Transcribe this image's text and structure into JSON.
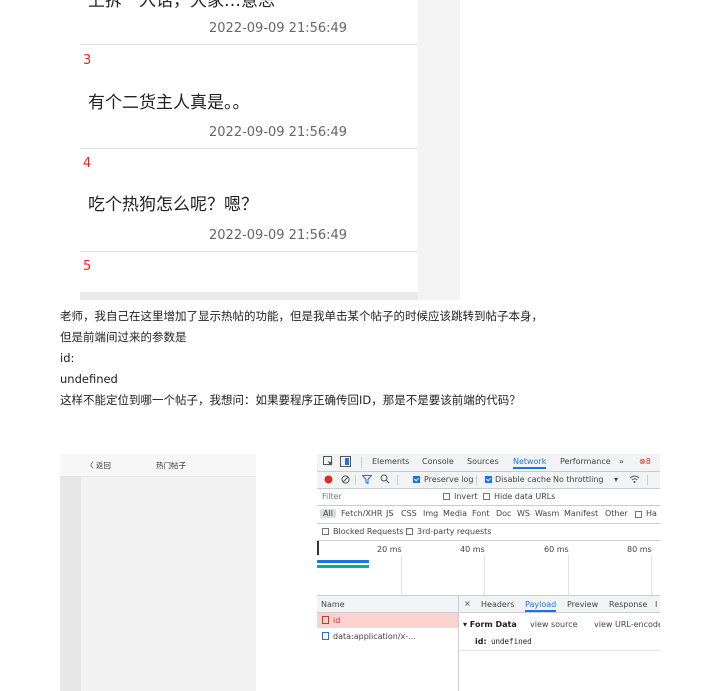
{
  "posts": [
    {
      "text": "",
      "time": "2022-09-09 21:56:49"
    },
    {
      "num": "3",
      "text": "有个二货主人真是。。",
      "time": "2022-09-09 21:56:49"
    },
    {
      "num": "4",
      "text": "吃个热狗怎么呢？嗯？",
      "time": "2022-09-09 21:56:49"
    },
    {
      "num": "5"
    }
  ],
  "question": {
    "line1": "老师，我自己在这里增加了显示热帖的功能，但是我单击某个帖子的时候应该跳转到帖子本身，",
    "line2": "但是前端间过来的参数是",
    "line3": "id:",
    "line4": "undefined",
    "line5": "这样不能定位到哪一个帖子，我想问：如果要程序正确传回ID，那是不是要该前端的代码？"
  },
  "phone": {
    "back": "〈 返回",
    "title": "热门帖子"
  },
  "devtools": {
    "tabs": [
      "Elements",
      "Console",
      "Sources",
      "Network",
      "Performance",
      "»"
    ],
    "active_tab": "Network",
    "error_badge": "8",
    "toolbar": {
      "preserve_log": "Preserve log",
      "disable_cache": "Disable cache",
      "throttling": "No throttling"
    },
    "filter": {
      "placeholder": "Filter",
      "invert": "Invert",
      "hide_data_urls": "Hide data URLs"
    },
    "types": [
      "All",
      "Fetch/XHR",
      "JS",
      "CSS",
      "Img",
      "Media",
      "Font",
      "Doc",
      "WS",
      "Wasm",
      "Manifest",
      "Other",
      "Ha"
    ],
    "blocked": {
      "blocked_requests": "Blocked Requests",
      "third_party": "3rd-party requests"
    },
    "timeline": [
      "20 ms",
      "40 ms",
      "60 ms",
      "80 ms"
    ],
    "name_header": "Name",
    "requests": [
      "id",
      "data:application/x-..."
    ],
    "detail_tabs": [
      "×",
      "Headers",
      "Payload",
      "Preview",
      "Response",
      "I"
    ],
    "active_detail_tab": "Payload",
    "form_data": {
      "title": "▾ Form Data",
      "view_source": "view source",
      "view_url": "view URL-encoded",
      "key": "id:",
      "value": "undefined"
    },
    "colors": {
      "accent": "#1a73e8",
      "error": "#d93025",
      "selected_row": "#fad2cf"
    }
  }
}
